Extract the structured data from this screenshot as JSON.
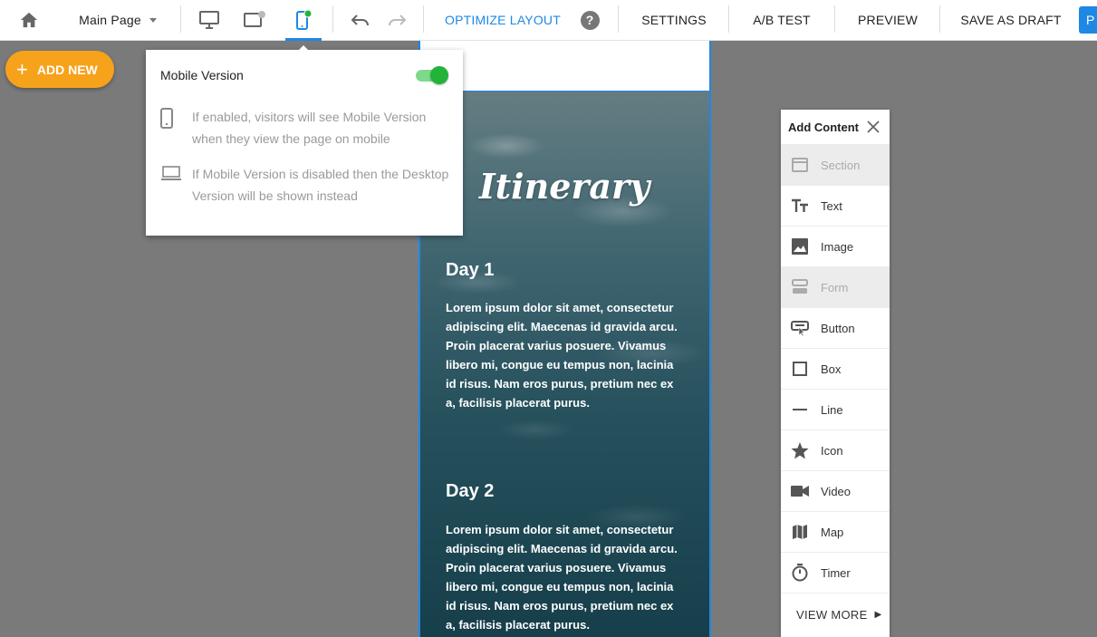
{
  "toolbar": {
    "page_selector": "Main Page",
    "optimize_layout": "OPTIMIZE LAYOUT",
    "help": "?",
    "settings": "SETTINGS",
    "ab_test": "A/B TEST",
    "preview": "PREVIEW",
    "save_draft": "SAVE AS DRAFT",
    "publish_partial": "P",
    "colors": {
      "accent": "#1e88e5",
      "mobile_status_dot": "#22b43a"
    }
  },
  "add_new": {
    "plus": "+",
    "label": "ADD NEW",
    "color": "#f7a21b"
  },
  "mobile_popover": {
    "title": "Mobile Version",
    "toggle_on": true,
    "rows": [
      {
        "icon": "smartphone-icon",
        "text": "If enabled, visitors will see Mobile Version when they view the page on mobile"
      },
      {
        "icon": "laptop-icon",
        "text": "If Mobile Version is disabled then the Desktop Version will be shown instead"
      }
    ]
  },
  "canvas": {
    "title": "Itinerary",
    "days": [
      {
        "title": "Day 1",
        "body": "Lorem ipsum dolor sit amet, consectetur adipiscing elit. Maecenas id gravida arcu. Proin placerat varius posuere. Vivamus libero mi, congue eu tempus non, lacinia id risus. Nam eros purus, pretium nec ex a, facilisis placerat purus."
      },
      {
        "title": "Day 2",
        "body": "Lorem ipsum dolor sit amet, consectetur adipiscing elit. Maecenas id gravida arcu. Proin placerat varius posuere. Vivamus libero mi, congue eu tempus non, lacinia id risus. Nam eros purus, pretium nec ex a, facilisis placerat purus."
      }
    ]
  },
  "add_content": {
    "title": "Add Content",
    "items": [
      {
        "label": "Section",
        "icon": "section-icon",
        "disabled": true
      },
      {
        "label": "Text",
        "icon": "text-icon",
        "disabled": false
      },
      {
        "label": "Image",
        "icon": "image-icon",
        "disabled": false
      },
      {
        "label": "Form",
        "icon": "form-icon",
        "disabled": true
      },
      {
        "label": "Button",
        "icon": "button-icon",
        "disabled": false
      },
      {
        "label": "Box",
        "icon": "box-icon",
        "disabled": false
      },
      {
        "label": "Line",
        "icon": "line-icon",
        "disabled": false
      },
      {
        "label": "Icon",
        "icon": "star-icon",
        "disabled": false
      },
      {
        "label": "Video",
        "icon": "video-icon",
        "disabled": false
      },
      {
        "label": "Map",
        "icon": "map-icon",
        "disabled": false
      },
      {
        "label": "Timer",
        "icon": "timer-icon",
        "disabled": false
      }
    ],
    "view_more": "VIEW MORE"
  }
}
